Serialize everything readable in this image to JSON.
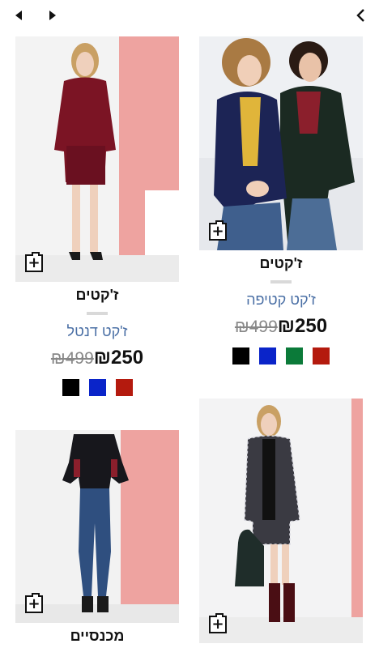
{
  "nav": {
    "prev_icon": "caret-left-icon",
    "next_icon": "caret-right-icon",
    "back_icon": "chevron-left-icon"
  },
  "products": [
    {
      "category": "ז'קטים",
      "name": "ז'קט קטיפה",
      "old_price": "₪499",
      "new_price": "₪250",
      "swatches": [
        "#000000",
        "#0a24c9",
        "#0b7a39",
        "#b41a0e"
      ]
    },
    {
      "category": "ז'קטים",
      "name": "ז'קט דנטל",
      "old_price": "₪499",
      "new_price": "₪250",
      "swatches": [
        "#000000",
        "#0a24c9",
        "#b41a0e"
      ]
    },
    {
      "category": "מכנסיים"
    },
    {}
  ],
  "colors": {
    "name_link": "#4a6fa5",
    "divider": "#d9d9d9",
    "backdrop_pink": "#eea3a0"
  }
}
